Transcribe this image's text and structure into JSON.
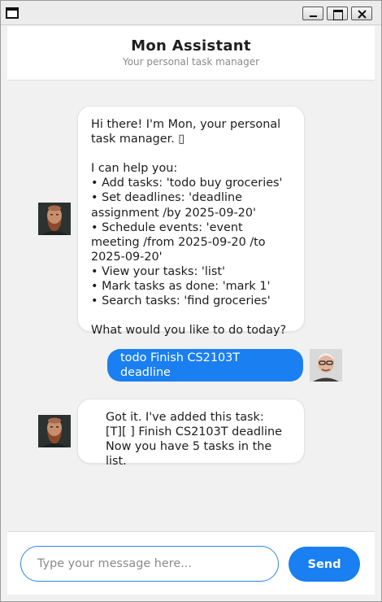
{
  "window": {
    "controls": {
      "minimize": "minimize-icon",
      "maximize": "maximize-icon",
      "close": "close-icon"
    }
  },
  "header": {
    "title": "Mon Assistant",
    "subtitle": "Your personal task manager"
  },
  "messages": [
    {
      "sender": "bot",
      "text": "Hi there! I'm Mon, your personal task manager. ▯\n\nI can help you:\n• Add tasks: 'todo buy groceries'\n• Set deadlines: 'deadline assignment /by 2025-09-20'\n• Schedule events: 'event meeting /from 2025-09-20 /to 2025-09-20'\n• View your tasks: 'list'\n• Mark tasks as done: 'mark 1'\n• Search tasks: 'find groceries'\n\nWhat would you like to do today?"
    },
    {
      "sender": "user",
      "text": "todo Finish CS2103T deadline"
    },
    {
      "sender": "bot",
      "text": "Got it. I've added this task:\n[T][ ] Finish CS2103T deadline\nNow you have 5 tasks in the list."
    }
  ],
  "input": {
    "placeholder": "Type your message here...",
    "value": ""
  },
  "send_button": {
    "label": "Send"
  },
  "colors": {
    "accent": "#1a7ff0",
    "bot_bubble": "#ffffff",
    "background": "#f1f1f1"
  }
}
